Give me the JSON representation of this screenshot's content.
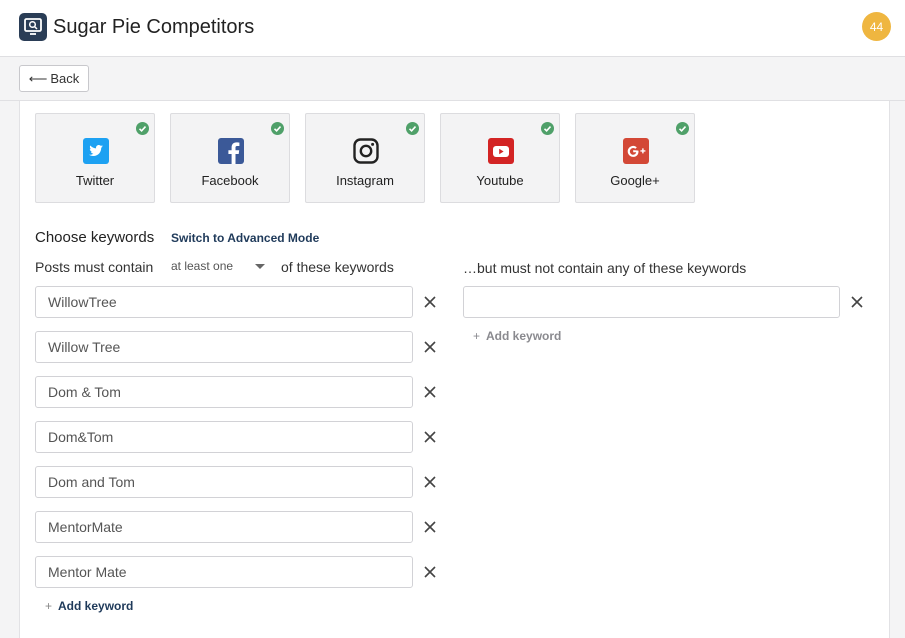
{
  "header": {
    "title": "Sugar Pie Competitors",
    "notification_count": "44",
    "app_icon": "monitor-search-icon"
  },
  "toolbar": {
    "back_label": "Back",
    "back_arrow": "⟵"
  },
  "networks": [
    {
      "label": "Twitter",
      "icon": "twitter-icon",
      "color": "#1da1f2",
      "selected": true
    },
    {
      "label": "Facebook",
      "icon": "facebook-icon",
      "color": "#3b5998",
      "selected": true
    },
    {
      "label": "Instagram",
      "icon": "instagram-icon",
      "color": "#222222",
      "selected": true
    },
    {
      "label": "Youtube",
      "icon": "youtube-icon",
      "color": "#d32424",
      "selected": true
    },
    {
      "label": "Google+",
      "icon": "google-plus-icon",
      "color": "#d34836",
      "selected": true
    }
  ],
  "keywords": {
    "section_title": "Choose keywords",
    "advanced_mode_link": "Switch to Advanced Mode",
    "include_prefix": "Posts must contain",
    "match_mode": "at least one",
    "include_suffix": "of these keywords",
    "exclude_label": "…but must not contain any of these keywords",
    "include_list": [
      "WillowTree",
      "Willow Tree",
      "Dom & Tom",
      "Dom&Tom",
      "Dom and Tom",
      "MentorMate",
      "Mentor Mate"
    ],
    "exclude_list": [
      ""
    ],
    "add_keyword_label": "Add keyword",
    "add_keyword_plus": "+"
  },
  "colors": {
    "accent": "#1f3a5a",
    "badge": "#efb640",
    "check": "#4fa069"
  }
}
